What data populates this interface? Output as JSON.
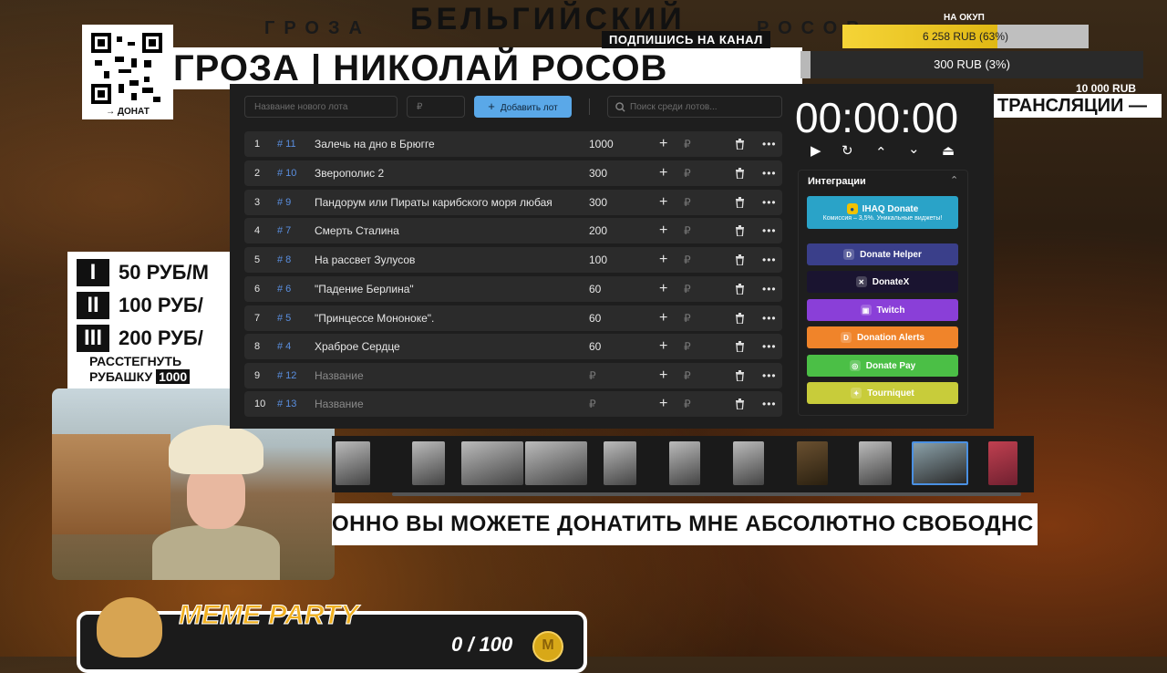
{
  "stream": {
    "header_small_left": "ГРОЗА",
    "header_big": "БЕЛЬГИЙСКИЙ",
    "header_small_right": "РОСОВ",
    "subscribe": "ПОДПИШИСЬ НА КАНАЛ",
    "main_title": "ГРОЗА | НИКОЛАЙ РОСОВ",
    "donate_label": "→ ДОНАТ",
    "goals": {
      "label": "НА ОКУП",
      "goal1_text": "6 258 RUB (63%)",
      "goal1_progress": 0.63,
      "goal2_text": "300 RUB (3%)",
      "goal2_progress": 0.03,
      "goal2_target": "10 000 RUB"
    },
    "right_banner": "ТРАНСЛЯЦИИ —",
    "price_board": {
      "rows": [
        {
          "roman": "I",
          "text": "50 РУБ/М"
        },
        {
          "roman": "II",
          "text": "100 РУБ/"
        },
        {
          "roman": "III",
          "text": "200 РУБ/"
        }
      ],
      "note_line1": "РАССТЕГНУТЬ",
      "note_line2": "РУБАШКУ",
      "note_amount": "1000"
    },
    "ticker": "ОННО ВЫ МОЖЕТЕ ДОНАТИТЬ МНЕ АБСОЛЮТНО СВОБОДНС",
    "meme_party": {
      "title": "MEME PARTY",
      "count": "0 / 100",
      "coin": "M"
    }
  },
  "app": {
    "new_lot_placeholder": "Название нового лота",
    "amount_placeholder": "₽",
    "add_button": "Добавить лот",
    "search_placeholder": "Поиск среди лотов...",
    "timer": "00:00:00",
    "lots": [
      {
        "idx": "1",
        "id": "# 11",
        "name": "Залечь на дно в Брюгге",
        "amount": "1000"
      },
      {
        "idx": "2",
        "id": "# 10",
        "name": "Зверополис 2",
        "amount": "300"
      },
      {
        "idx": "3",
        "id": "# 9",
        "name": "Пандорум или Пираты карибского моря любая",
        "amount": "300"
      },
      {
        "idx": "4",
        "id": "# 7",
        "name": "Смерть Сталина",
        "amount": "200"
      },
      {
        "idx": "5",
        "id": "# 8",
        "name": "На рассвет Зулусов",
        "amount": "100"
      },
      {
        "idx": "6",
        "id": "# 6",
        "name": "\"Падение Берлина\"",
        "amount": "60"
      },
      {
        "idx": "7",
        "id": "# 5",
        "name": "\"Принцессе Мононоке\".",
        "amount": "60"
      },
      {
        "idx": "8",
        "id": "# 4",
        "name": "Храброе Сердце",
        "amount": "60"
      },
      {
        "idx": "9",
        "id": "# 12",
        "name": "Название",
        "amount": "₽"
      },
      {
        "idx": "10",
        "id": "# 13",
        "name": "Название",
        "amount": "₽"
      }
    ],
    "row_plus": "+",
    "row_currency": "₽",
    "integrations": {
      "title": "Интеграции",
      "services": [
        {
          "name": "IHAQ Donate",
          "sub": "Комиссия – 3,5%. Уникальные виджеты!",
          "color": "#2aa3c8"
        },
        {
          "name": "Donate Helper",
          "color": "#3a3f8a"
        },
        {
          "name": "DonateX",
          "color": "#1a1430"
        },
        {
          "name": "Twitch",
          "color": "#8a3fd8"
        },
        {
          "name": "Donation Alerts",
          "color": "#f0842a"
        },
        {
          "name": "Donate Pay",
          "color": "#4bbf46"
        },
        {
          "name": "Tourniquet",
          "color": "#c8cc3a"
        }
      ]
    }
  }
}
